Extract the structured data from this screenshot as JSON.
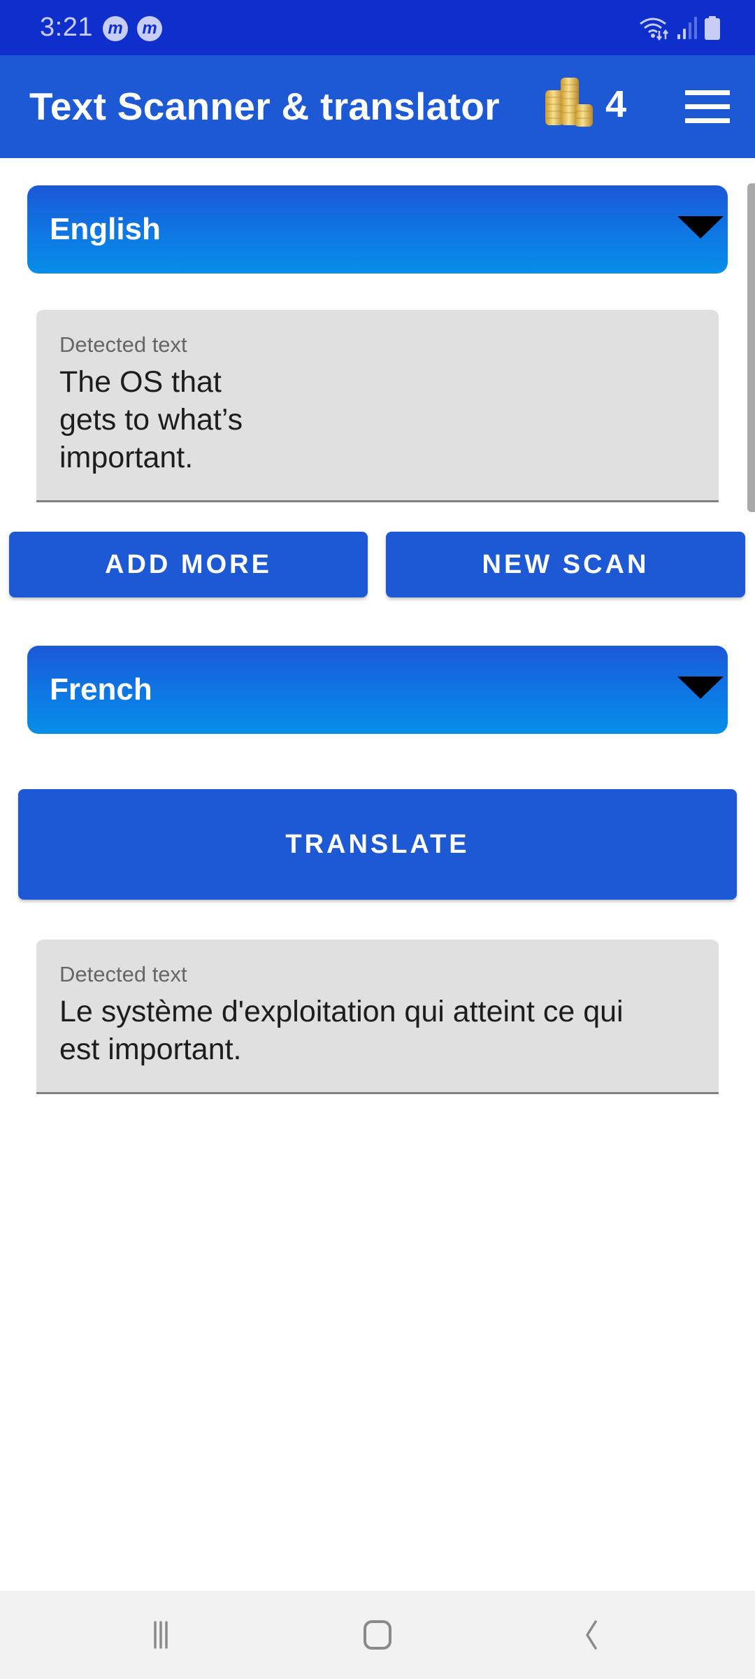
{
  "status_bar": {
    "time": "3:21",
    "notification_icons": [
      "m",
      "m"
    ],
    "indicators": [
      "wifi-data-icon",
      "signal-icon",
      "battery-icon"
    ]
  },
  "app_bar": {
    "title": "Text Scanner & translator",
    "coin_icon": "coins-stack-icon",
    "coin_count": "4",
    "menu_icon": "hamburger-menu-icon"
  },
  "source": {
    "language": "English",
    "field_label": "Detected text",
    "text": "The OS that\ngets to what’s\nimportant."
  },
  "actions": {
    "add_more_label": "ADD MORE",
    "new_scan_label": "NEW SCAN"
  },
  "target": {
    "language": "French",
    "translate_label": "TRANSLATE",
    "field_label": "Detected text",
    "text": "Le système d'exploitation qui atteint ce qui\nest important."
  },
  "nav_bar": {
    "items": [
      "recent-apps",
      "home",
      "back"
    ]
  },
  "colors": {
    "status_bar": "#0f2fcc",
    "primary": "#1e59d5",
    "spinner_gradient_end": "#068ee8",
    "field_background": "#e0e0e0",
    "nav_bar": "#f2f2f2"
  }
}
